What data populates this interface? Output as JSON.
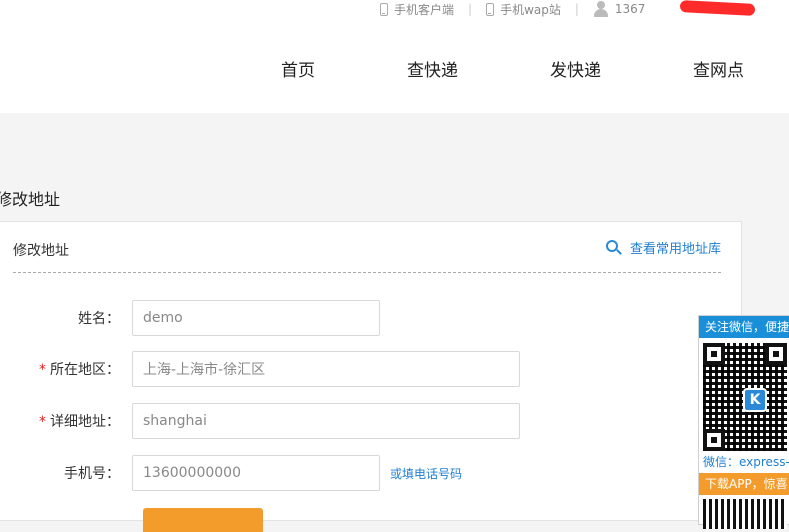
{
  "topbar": {
    "app_client": "手机客户端",
    "wap_site": "手机wap站",
    "phone_masked": "1367"
  },
  "nav": {
    "home": "首页",
    "track": "查快递",
    "send": "发快递",
    "outlets": "查网点"
  },
  "page": {
    "title": "修改地址"
  },
  "card": {
    "title": "修改地址",
    "address_library_link": "查看常用地址库",
    "fields": {
      "name_label": "姓名：",
      "name_value": "demo",
      "region_label": "所在地区：",
      "region_value": "上海-上海市-徐汇区",
      "detail_label": "详细地址：",
      "detail_value": "shanghai",
      "mobile_label": "手机号：",
      "mobile_value": "13600000000",
      "phone_alt_link": "或填电话号码"
    },
    "required_mark": "*"
  },
  "float_panel": {
    "follow_wechat": "关注微信，便捷",
    "wechat_id": "微信：express-l",
    "download_app": "下载APP，惊喜",
    "qr_logo": "K"
  },
  "colors": {
    "link": "#1f7fd0",
    "accent_orange": "#f39c2b",
    "required": "#e02020",
    "wechat_blue": "#1a8fd9"
  }
}
